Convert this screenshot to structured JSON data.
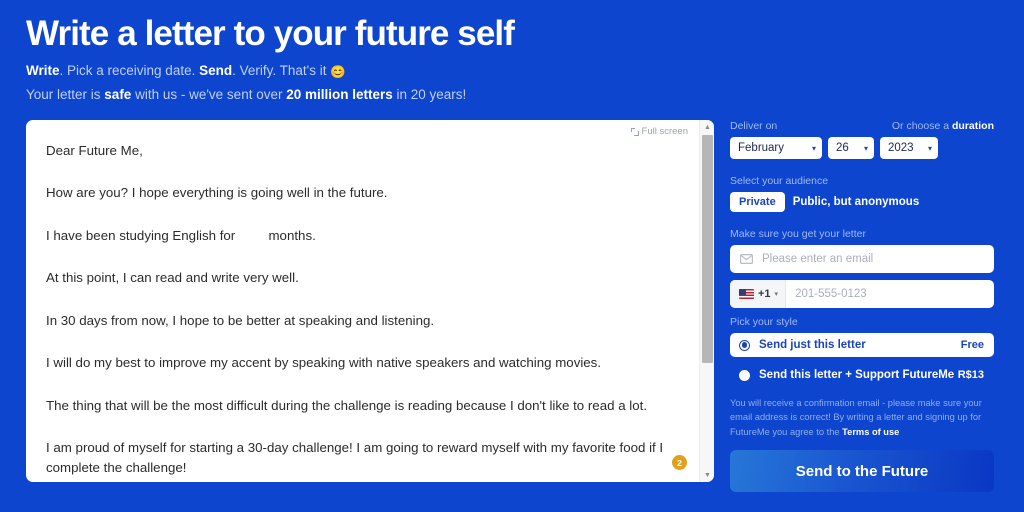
{
  "header": {
    "title": "Write a letter to your future self",
    "tagline_parts": [
      {
        "text": "Write",
        "bold": true
      },
      {
        "text": ". Pick a receiving date. ",
        "bold": false
      },
      {
        "text": "Send",
        "bold": true
      },
      {
        "text": ". Verify. That's it ",
        "bold": false
      }
    ],
    "tagline_emoji": "😊",
    "trust_parts": [
      {
        "text": "Your letter is ",
        "bold": false
      },
      {
        "text": "safe",
        "bold": true
      },
      {
        "text": " with us - we've sent over ",
        "bold": false
      },
      {
        "text": "20 million letters",
        "bold": true
      },
      {
        "text": " in 20 years!",
        "bold": false
      }
    ]
  },
  "letter": {
    "fullscreen_label": "Full screen",
    "fullscreen_icon": "expand-icon",
    "badge_count": "2",
    "paragraphs": [
      "Dear Future Me,",
      "How are you? I hope everything is going well in the future.",
      "I have been studying English for         months.",
      "At this point, I can read and write very well.",
      "In 30 days from now, I hope to be better at speaking and listening.",
      "I will do my best to improve my accent by speaking with native speakers and watching movies.",
      "The thing that will be the most difficult during the challenge is reading because I don't like to read a lot.",
      "I am proud of myself for starting a 30-day challenge! I am going to reward myself with my favorite food if I complete the challenge!"
    ],
    "scroll_up_icon": "▲",
    "scroll_down_icon": "▼"
  },
  "sidebar": {
    "deliver_on_label": "Deliver on",
    "duration_link": {
      "prefix": "Or choose a ",
      "emphasis": "duration"
    },
    "date": {
      "month": "February",
      "day": "26",
      "year": "2023",
      "caret_icon": "chevron-down-icon"
    },
    "audience_label": "Select your audience",
    "audience_options": [
      {
        "label": "Private",
        "selected": true
      },
      {
        "label": "Public, but anonymous",
        "selected": false
      }
    ],
    "delivery_label": "Make sure you get your letter",
    "email_field": {
      "placeholder": "Please enter an email",
      "value": "",
      "icon": "envelope-icon"
    },
    "phone_field": {
      "country_flag": "us-flag-icon",
      "country_code": "+1",
      "placeholder": "201-555-0123",
      "value": "",
      "caret_icon": "caret-down-icon"
    },
    "style_label": "Pick your style",
    "style_options": [
      {
        "label": "Send just this letter",
        "price": "Free",
        "selected": true
      },
      {
        "label": "Send this letter + Support FutureMe",
        "price": "R$13",
        "selected": false
      }
    ],
    "disclaimer": {
      "text": "You will receive a confirmation email - please make sure your email address is correct! By writing a letter and signing up for FutureMe you agree to the ",
      "link": "Terms of use"
    },
    "submit_label": "Send to the Future"
  },
  "colors": {
    "background": "#0D45CE",
    "accent_badge": "#E3A11B",
    "button_gradient_start": "#2777D8",
    "button_gradient_end": "#0A37C4",
    "muted_text": "#9FBAEE"
  }
}
